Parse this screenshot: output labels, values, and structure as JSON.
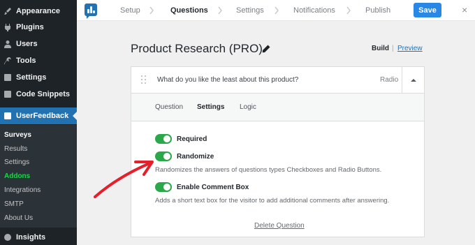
{
  "sidebar": {
    "items": [
      {
        "label": "Appearance",
        "icon": "paintbrush-icon"
      },
      {
        "label": "Plugins",
        "icon": "plug-icon"
      },
      {
        "label": "Users",
        "icon": "user-icon"
      },
      {
        "label": "Tools",
        "icon": "wrench-icon"
      },
      {
        "label": "Settings",
        "icon": "sliders-icon"
      },
      {
        "label": "Code Snippets",
        "icon": "code-icon"
      },
      {
        "label": "UserFeedback",
        "icon": "userfeedback-icon"
      }
    ],
    "submenu": [
      "Surveys",
      "Results",
      "Settings",
      "Addons",
      "Integrations",
      "SMTP",
      "About Us"
    ],
    "insights": {
      "label": "Insights",
      "icon": "insights-icon"
    }
  },
  "topbar": {
    "steps": [
      "Setup",
      "Questions",
      "Settings",
      "Notifications",
      "Publish"
    ],
    "save_label": "Save",
    "close_glyph": "×"
  },
  "main": {
    "survey_title": "Product Research (PRO)",
    "build_label": "Build",
    "separator": "|",
    "preview_label": "Preview",
    "question": {
      "text": "What do you like the least about this product?",
      "type": "Radio"
    },
    "tabs": [
      "Question",
      "Settings",
      "Logic"
    ],
    "options": [
      {
        "label": "Required",
        "on": true
      },
      {
        "label": "Randomize",
        "on": true,
        "description": "Randomizes the answers of questions types Checkboxes and Radio Buttons."
      },
      {
        "label": "Enable Comment Box",
        "on": true,
        "description": "Adds a short text box for the visitor to add additional comments after answering."
      }
    ],
    "delete_label": "Delete Question"
  },
  "colors": {
    "sidebar_bg": "#1d2327",
    "active_menu": "#2271b1",
    "toggle_on": "#2ba84a",
    "save_button": "#2987e6",
    "annotation_arrow": "#e5202b",
    "addons_link": "#1ed14b"
  }
}
